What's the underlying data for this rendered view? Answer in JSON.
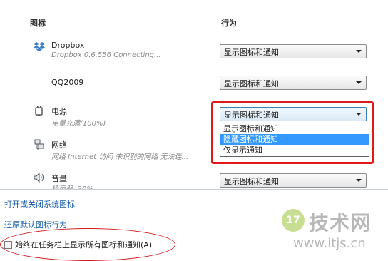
{
  "columns": {
    "icons": "图标",
    "behaviors": "行为"
  },
  "rows": [
    {
      "icon": "dropbox-icon",
      "name": "Dropbox",
      "desc": "Dropbox 0.6.556 Connecting...",
      "behavior": "显示图标和通知"
    },
    {
      "icon": "qq-icon",
      "name": "QQ2009",
      "desc": "",
      "behavior": "显示图标和通知"
    },
    {
      "icon": "power-icon",
      "name": "电源",
      "desc": "电量充满(100%)",
      "behavior": "显示图标和通知"
    },
    {
      "icon": "network-icon",
      "name": "网络",
      "desc": "网络 Internet 访问 未识别的网络 无法连...",
      "behavior": ""
    },
    {
      "icon": "volume-icon",
      "name": "音量",
      "desc": "扬声器: 30%",
      "behavior": "显示图标和通知"
    }
  ],
  "dropdown": {
    "options": [
      "显示图标和通知",
      "隐藏图标和通知",
      "仅显示通知"
    ],
    "highlighted": "隐藏图标和通知"
  },
  "links": {
    "toggle_system_icons": "打开或关闭系统图标",
    "restore_defaults": "还原默认图标行为"
  },
  "checkbox": {
    "label": "始终在任务栏上显示所有图标和通知(A)",
    "checked": false
  },
  "watermark": {
    "logo_glyph": "17",
    "brand": "技术网",
    "url": "www.itjs.cn"
  },
  "colors": {
    "link": "#1a5eaa",
    "highlight": "#3399ff",
    "annotation": "#e01a1a"
  }
}
